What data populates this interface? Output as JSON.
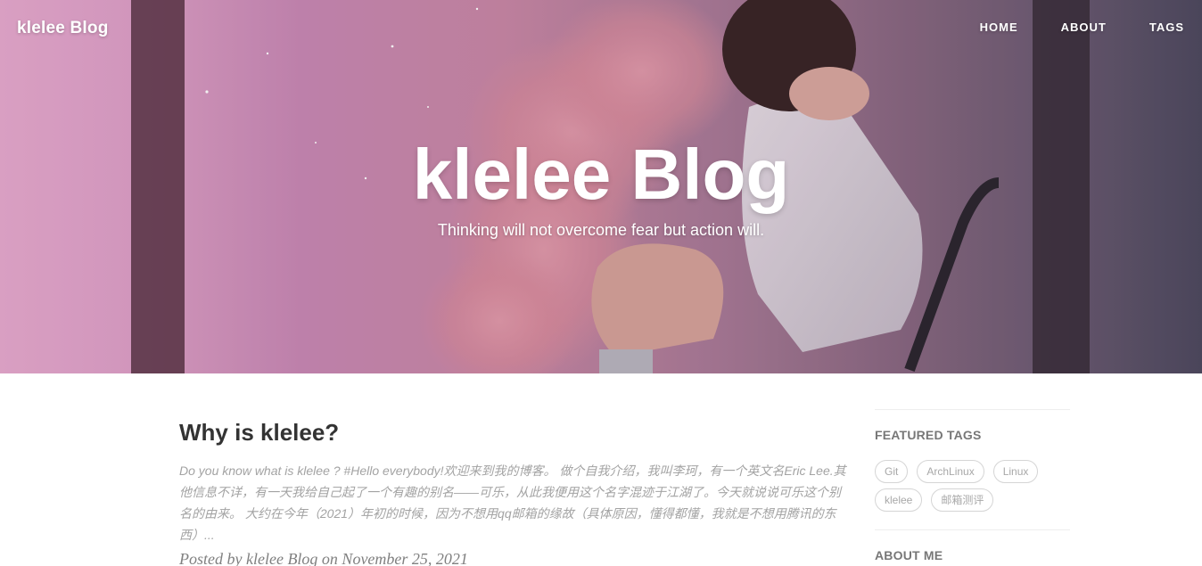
{
  "nav": {
    "brand": "klelee Blog",
    "links": [
      "HOME",
      "ABOUT",
      "TAGS"
    ]
  },
  "hero": {
    "title": "klelee Blog",
    "subtitle": "Thinking will not overcome fear but action will."
  },
  "post": {
    "title": "Why is klelee?",
    "excerpt": "Do you know what is klelee ? #Hello everybody!欢迎来到我的博客。 做个自我介绍，我叫李珂，有一个英文名Eric Lee.其他信息不详，有一天我给自己起了一个有趣的别名——可乐，从此我便用这个名字混迹于江湖了。今天就说说可乐这个别名的由来。 大约在今年（2021）年初的时候，因为不想用qq邮箱的缘故（具体原因，懂得都懂，我就是不想用腾讯的东西）...",
    "meta": "Posted by klelee Blog on November 25, 2021"
  },
  "sidebar": {
    "featured_tags_title": "FEATURED TAGS",
    "tags": [
      "Git",
      "ArchLinux",
      "Linux",
      "klelee",
      "邮箱测评"
    ],
    "about_title": "ABOUT ME"
  },
  "colors": {
    "hero_pink": "#e7a9cf",
    "hero_dark": "#4f4a60",
    "tag_border": "#d5d5d5",
    "excerpt_text": "#a3a3a3"
  }
}
